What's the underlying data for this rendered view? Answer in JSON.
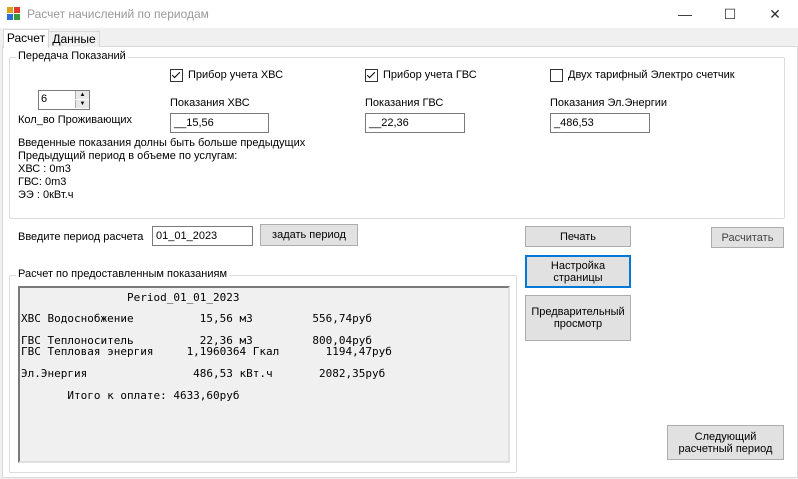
{
  "window": {
    "title": "Расчет начислений по периодам",
    "minimize_glyph": "—",
    "maximize_glyph": "☐",
    "close_glyph": "✕"
  },
  "tabs": [
    {
      "label": "Расчет",
      "active": true
    },
    {
      "label": "Данные",
      "active": false
    }
  ],
  "readings_group": {
    "legend": "Передача Показаний",
    "residents_value": "6",
    "residents_label": "Кол_во Проживающих",
    "cold_meter": {
      "label": "Прибор учета ХВС",
      "checked": true,
      "field_label": "Показания ХВС",
      "value": "__15,56"
    },
    "hot_meter": {
      "label": "Прибор учета ГВС",
      "checked": true,
      "field_label": "Показания ГВС",
      "value": "__22,36"
    },
    "electro_meter": {
      "label": "Двух тарифный Электро счетчик",
      "checked": false,
      "field_label": "Показания Эл.Энергии",
      "value": "_486,53"
    },
    "info_lines": [
      "Введенные показания долны быть больше предыдущих",
      "Предыдущий период в объеме по услугам:",
      "ХВС : 0m3",
      "ГВС: 0m3",
      "ЭЭ : 0кВт.ч"
    ]
  },
  "period": {
    "label": "Введите период расчета",
    "value": "01_01_2023",
    "set_button": "задать период"
  },
  "buttons": {
    "print": "Печать",
    "page_setup": "Настройка страницы",
    "preview": "Предварительный просмотр",
    "calculate": "Расчитать",
    "next_period": "Следующий расчетный период"
  },
  "result_group": {
    "legend": "Расчет по предоставленным показаниям",
    "lines": [
      "                Period_01_01_2023",
      "",
      "ХВС Водоснобжение          15,56 м3         556,74руб",
      "",
      "ГВС Теплоноситель          22,36 м3         800,04руб",
      "ГВС Тепловая энергия     1,1960364 Гкал       1194,47руб",
      "",
      "Эл.Энергия                486,53 кВт.ч       2082,35руб",
      "",
      "       Итого к оплате: 4633,60руб"
    ]
  }
}
